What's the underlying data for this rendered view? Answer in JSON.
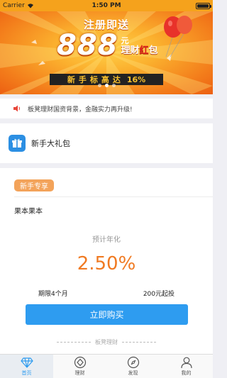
{
  "status_bar": {
    "carrier": "Carrier",
    "time": "1:50 PM",
    "battery_level": 1.0,
    "wifi_icon": "wifi-icon",
    "battery_icon": "battery-icon"
  },
  "banner": {
    "headline": "注册即送",
    "amount": "888",
    "unit": "元",
    "product_prefix": "理财",
    "product_highlight": "红",
    "product_suffix": "包",
    "strip_spaced": "新手标高达",
    "strip_rate": "16%",
    "page_count": 3,
    "active_page": 1,
    "colors": {
      "orange": "#f37d1b",
      "yellow": "#ffd24a",
      "red": "#e0231e",
      "strip": "#222222"
    }
  },
  "notice": {
    "icon": "speaker-icon",
    "text": "板凳理财国资背景，金融实力再升级!"
  },
  "gift": {
    "icon": "gift-icon",
    "label": "新手大礼包"
  },
  "product_card": {
    "tag": "新手专享",
    "name": "果本果本",
    "rate_label": "预计年化",
    "rate": "2.50%",
    "term": "期限4个月",
    "min_investment": "200元起投",
    "buy_button": "立即购买",
    "footer": "板凳理财",
    "colors": {
      "tag": "#f3a35a",
      "rate": "#f07a22",
      "button": "#2e9cf0"
    }
  },
  "tab_bar": {
    "tabs": [
      {
        "label": "首页",
        "icon": "diamond-icon",
        "active": true
      },
      {
        "label": "理财",
        "icon": "diamond-circle-icon",
        "active": false
      },
      {
        "label": "发现",
        "icon": "compass-icon",
        "active": false
      },
      {
        "label": "我的",
        "icon": "person-icon",
        "active": false
      }
    ],
    "active_color": "#2e9cf0"
  }
}
